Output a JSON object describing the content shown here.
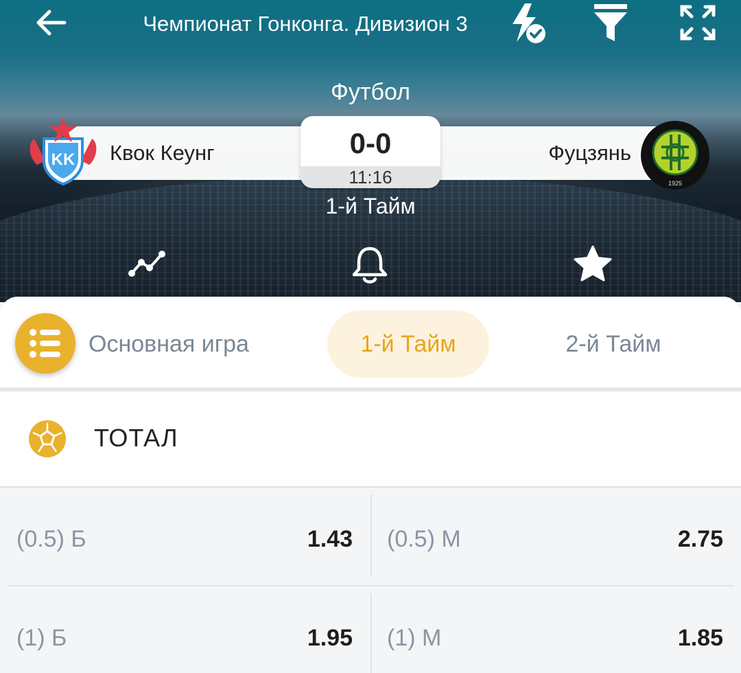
{
  "header": {
    "title": "Чемпионат Гонконга. Дивизион 3",
    "sport": "Футбол",
    "period": "1-й Тайм",
    "score": "0-0",
    "timer": "11:16",
    "home_team": {
      "name": "Квок Кеунг",
      "logo_text": "KK"
    },
    "away_team": {
      "name": "Фуцзянь",
      "logo_text": "FUKIEN ATHLETIC CLUB 1925"
    }
  },
  "toolbar_icons": [
    "back-arrow-icon",
    "quick-bet-icon",
    "filter-icon",
    "expand-icon"
  ],
  "actions": [
    "stats-chart-icon",
    "bell-icon",
    "star-icon"
  ],
  "tabs": [
    {
      "label": "Основная игра",
      "active": false
    },
    {
      "label": "1-й Тайм",
      "active": true
    },
    {
      "label": "2-й Тайм",
      "active": false
    }
  ],
  "market": {
    "title": "ТОТАЛ",
    "rows": [
      {
        "left_label": "(0.5) Б",
        "left_value": "1.43",
        "right_label": "(0.5) М",
        "right_value": "2.75"
      },
      {
        "left_label": "(1) Б",
        "left_value": "1.95",
        "right_label": "(1) М",
        "right_value": "1.85"
      }
    ]
  },
  "colors": {
    "accent": "#e8b22d",
    "active_tab_bg": "#fdf2de",
    "active_tab_text": "#e6a51f",
    "header_top": "#0d6f82"
  }
}
